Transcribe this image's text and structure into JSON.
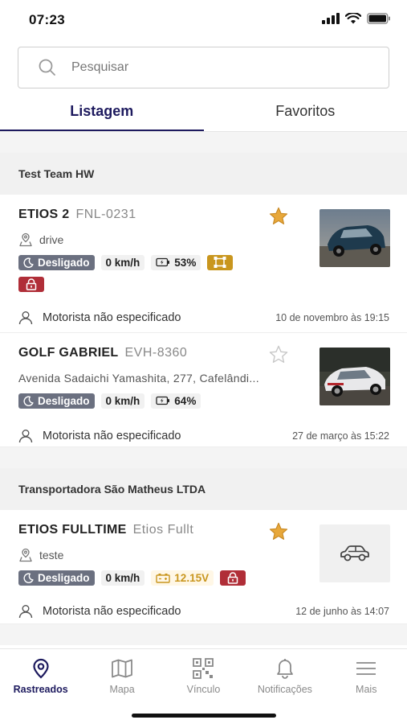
{
  "status": {
    "time": "07:23"
  },
  "search": {
    "placeholder": "Pesquisar"
  },
  "tabs": [
    {
      "label": "Listagem",
      "active": true
    },
    {
      "label": "Favoritos",
      "active": false
    }
  ],
  "groups": [
    {
      "name": "Test Team HW",
      "items": [
        {
          "name": "ETIOS 2",
          "plate": "FNL-0231",
          "favorite": true,
          "location": "drive",
          "status": "Desligado",
          "speed": "0 km/h",
          "battery": "53%",
          "driver": "Motorista não especificado",
          "date": "10 de novembro às 19:15"
        },
        {
          "name": "GOLF GABRIEL",
          "plate": "EVH-8360",
          "favorite": false,
          "address": "Avenida Sadaichi Yamashita, 277, Cafelândi...",
          "status": "Desligado",
          "speed": "0 km/h",
          "battery": "64%",
          "driver": "Motorista não especificado",
          "date": "27 de março às 15:22"
        }
      ]
    },
    {
      "name": "Transportadora São Matheus LTDA",
      "items": [
        {
          "name": "ETIOS FULLTIME",
          "plate": "Etios Fullt",
          "favorite": true,
          "location": "teste",
          "status": "Desligado",
          "speed": "0 km/h",
          "voltage": "12.15V",
          "driver": "Motorista não especificado",
          "date": "12 de junho às 14:07"
        }
      ]
    }
  ],
  "nav": [
    {
      "label": "Rastreados",
      "icon": "location-pin-icon",
      "active": true
    },
    {
      "label": "Mapa",
      "icon": "map-icon",
      "active": false
    },
    {
      "label": "Vínculo",
      "icon": "qr-code-icon",
      "active": false
    },
    {
      "label": "Notificações",
      "icon": "bell-icon",
      "active": false
    },
    {
      "label": "Mais",
      "icon": "menu-icon",
      "active": false
    }
  ],
  "colors": {
    "primary": "#1d1a5e",
    "status_off": "#6b7080",
    "star": "#e8a83a",
    "warning": "#c9961e",
    "danger": "#b02e38"
  }
}
